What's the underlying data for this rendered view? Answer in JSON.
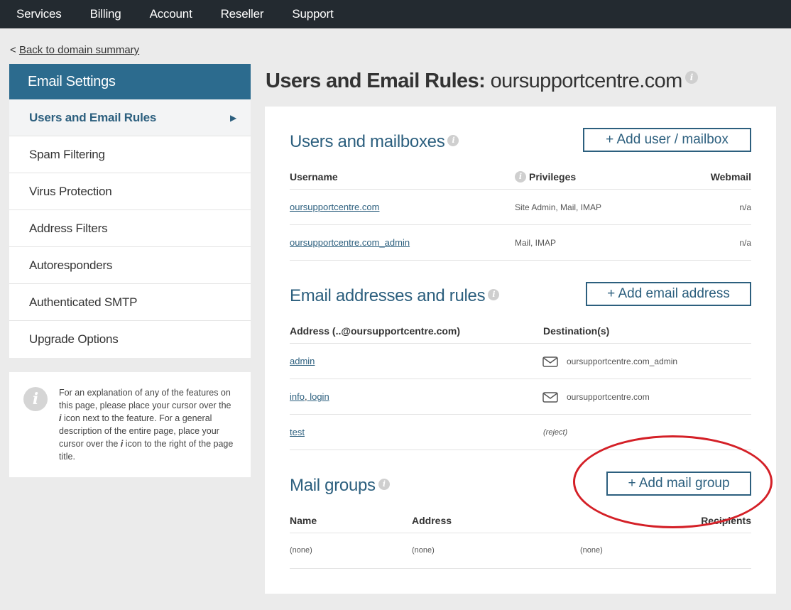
{
  "nav": [
    "Services",
    "Billing",
    "Account",
    "Reseller",
    "Support"
  ],
  "back_link": {
    "prefix": "< ",
    "label": "Back to domain summary"
  },
  "sidebar": {
    "header": "Email Settings",
    "items": [
      {
        "label": "Users and Email Rules",
        "active": true
      },
      {
        "label": "Spam Filtering"
      },
      {
        "label": "Virus Protection"
      },
      {
        "label": "Address Filters"
      },
      {
        "label": "Autoresponders"
      },
      {
        "label": "Authenticated SMTP"
      },
      {
        "label": "Upgrade Options"
      }
    ],
    "active_arrow": "▶"
  },
  "infobox": {
    "icon": "i",
    "p1": "For an explanation of any of the features on this page, please place your cursor over the ",
    "i1": "i",
    "p2": " icon next to the feature. For a general description of the entire page, place your cursor over the ",
    "i2": "i",
    "p3": " icon to the right of the page title."
  },
  "page": {
    "title_bold": "Users and Email Rules:",
    "title_domain": "oursupportcentre.com",
    "info_icon": "i"
  },
  "users": {
    "title": "Users and mailboxes",
    "add_button": "+ Add user / mailbox",
    "columns": [
      "Username",
      "Privileges",
      "Webmail"
    ],
    "rows": [
      {
        "username": "oursupportcentre.com",
        "privileges": "Site Admin, Mail, IMAP",
        "webmail": "n/a"
      },
      {
        "username": "oursupportcentre.com_admin",
        "privileges": "Mail, IMAP",
        "webmail": "n/a"
      }
    ]
  },
  "addresses": {
    "title": "Email addresses and rules",
    "add_button": "+ Add email address",
    "columns": [
      "Address (..@oursupportcentre.com)",
      "Destination(s)"
    ],
    "rows": [
      {
        "address": "admin",
        "destination": "oursupportcentre.com_admin"
      },
      {
        "address_a": "info",
        "sep": ", ",
        "address_b": "login",
        "destination": "oursupportcentre.com"
      },
      {
        "address": "test",
        "destination": "(reject)"
      }
    ]
  },
  "groups": {
    "title": "Mail groups",
    "add_button": "+ Add mail group",
    "columns": [
      "Name",
      "Address",
      "Recipients"
    ],
    "rows": [
      {
        "name": "(none)",
        "address": "(none)",
        "recipients": "(none)"
      }
    ]
  },
  "colors": {
    "accent": "#2c6b8e",
    "nav_bg": "#232a30",
    "annotation": "#d42027"
  }
}
